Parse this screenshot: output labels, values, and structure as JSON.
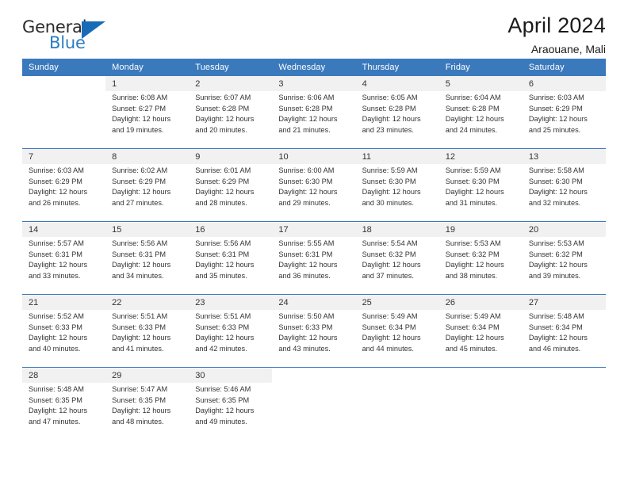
{
  "brand": {
    "word_top": "General",
    "word_bottom": "Blue",
    "triangle_color": "#1a6bb5",
    "blue_text_color": "#2b7cc4"
  },
  "header": {
    "title": "April 2024",
    "subtitle": "Araouane, Mali"
  },
  "theme": {
    "header_row_bg": "#3b79bd",
    "header_row_text": "#ffffff",
    "daynum_band_bg": "#f1f1f1",
    "week_divider": "#3b79bd",
    "body_text": "#333333"
  },
  "labels": {
    "sunrise_prefix": "Sunrise:",
    "sunset_prefix": "Sunset:",
    "daylight_prefix": "Daylight:"
  },
  "columns": [
    "Sunday",
    "Monday",
    "Tuesday",
    "Wednesday",
    "Thursday",
    "Friday",
    "Saturday"
  ],
  "weeks": [
    [
      {
        "day": "",
        "lines": []
      },
      {
        "day": "1",
        "lines": [
          "Sunrise: 6:08 AM",
          "Sunset: 6:27 PM",
          "Daylight: 12 hours",
          "and 19 minutes."
        ]
      },
      {
        "day": "2",
        "lines": [
          "Sunrise: 6:07 AM",
          "Sunset: 6:28 PM",
          "Daylight: 12 hours",
          "and 20 minutes."
        ]
      },
      {
        "day": "3",
        "lines": [
          "Sunrise: 6:06 AM",
          "Sunset: 6:28 PM",
          "Daylight: 12 hours",
          "and 21 minutes."
        ]
      },
      {
        "day": "4",
        "lines": [
          "Sunrise: 6:05 AM",
          "Sunset: 6:28 PM",
          "Daylight: 12 hours",
          "and 23 minutes."
        ]
      },
      {
        "day": "5",
        "lines": [
          "Sunrise: 6:04 AM",
          "Sunset: 6:28 PM",
          "Daylight: 12 hours",
          "and 24 minutes."
        ]
      },
      {
        "day": "6",
        "lines": [
          "Sunrise: 6:03 AM",
          "Sunset: 6:29 PM",
          "Daylight: 12 hours",
          "and 25 minutes."
        ]
      }
    ],
    [
      {
        "day": "7",
        "lines": [
          "Sunrise: 6:03 AM",
          "Sunset: 6:29 PM",
          "Daylight: 12 hours",
          "and 26 minutes."
        ]
      },
      {
        "day": "8",
        "lines": [
          "Sunrise: 6:02 AM",
          "Sunset: 6:29 PM",
          "Daylight: 12 hours",
          "and 27 minutes."
        ]
      },
      {
        "day": "9",
        "lines": [
          "Sunrise: 6:01 AM",
          "Sunset: 6:29 PM",
          "Daylight: 12 hours",
          "and 28 minutes."
        ]
      },
      {
        "day": "10",
        "lines": [
          "Sunrise: 6:00 AM",
          "Sunset: 6:30 PM",
          "Daylight: 12 hours",
          "and 29 minutes."
        ]
      },
      {
        "day": "11",
        "lines": [
          "Sunrise: 5:59 AM",
          "Sunset: 6:30 PM",
          "Daylight: 12 hours",
          "and 30 minutes."
        ]
      },
      {
        "day": "12",
        "lines": [
          "Sunrise: 5:59 AM",
          "Sunset: 6:30 PM",
          "Daylight: 12 hours",
          "and 31 minutes."
        ]
      },
      {
        "day": "13",
        "lines": [
          "Sunrise: 5:58 AM",
          "Sunset: 6:30 PM",
          "Daylight: 12 hours",
          "and 32 minutes."
        ]
      }
    ],
    [
      {
        "day": "14",
        "lines": [
          "Sunrise: 5:57 AM",
          "Sunset: 6:31 PM",
          "Daylight: 12 hours",
          "and 33 minutes."
        ]
      },
      {
        "day": "15",
        "lines": [
          "Sunrise: 5:56 AM",
          "Sunset: 6:31 PM",
          "Daylight: 12 hours",
          "and 34 minutes."
        ]
      },
      {
        "day": "16",
        "lines": [
          "Sunrise: 5:56 AM",
          "Sunset: 6:31 PM",
          "Daylight: 12 hours",
          "and 35 minutes."
        ]
      },
      {
        "day": "17",
        "lines": [
          "Sunrise: 5:55 AM",
          "Sunset: 6:31 PM",
          "Daylight: 12 hours",
          "and 36 minutes."
        ]
      },
      {
        "day": "18",
        "lines": [
          "Sunrise: 5:54 AM",
          "Sunset: 6:32 PM",
          "Daylight: 12 hours",
          "and 37 minutes."
        ]
      },
      {
        "day": "19",
        "lines": [
          "Sunrise: 5:53 AM",
          "Sunset: 6:32 PM",
          "Daylight: 12 hours",
          "and 38 minutes."
        ]
      },
      {
        "day": "20",
        "lines": [
          "Sunrise: 5:53 AM",
          "Sunset: 6:32 PM",
          "Daylight: 12 hours",
          "and 39 minutes."
        ]
      }
    ],
    [
      {
        "day": "21",
        "lines": [
          "Sunrise: 5:52 AM",
          "Sunset: 6:33 PM",
          "Daylight: 12 hours",
          "and 40 minutes."
        ]
      },
      {
        "day": "22",
        "lines": [
          "Sunrise: 5:51 AM",
          "Sunset: 6:33 PM",
          "Daylight: 12 hours",
          "and 41 minutes."
        ]
      },
      {
        "day": "23",
        "lines": [
          "Sunrise: 5:51 AM",
          "Sunset: 6:33 PM",
          "Daylight: 12 hours",
          "and 42 minutes."
        ]
      },
      {
        "day": "24",
        "lines": [
          "Sunrise: 5:50 AM",
          "Sunset: 6:33 PM",
          "Daylight: 12 hours",
          "and 43 minutes."
        ]
      },
      {
        "day": "25",
        "lines": [
          "Sunrise: 5:49 AM",
          "Sunset: 6:34 PM",
          "Daylight: 12 hours",
          "and 44 minutes."
        ]
      },
      {
        "day": "26",
        "lines": [
          "Sunrise: 5:49 AM",
          "Sunset: 6:34 PM",
          "Daylight: 12 hours",
          "and 45 minutes."
        ]
      },
      {
        "day": "27",
        "lines": [
          "Sunrise: 5:48 AM",
          "Sunset: 6:34 PM",
          "Daylight: 12 hours",
          "and 46 minutes."
        ]
      }
    ],
    [
      {
        "day": "28",
        "lines": [
          "Sunrise: 5:48 AM",
          "Sunset: 6:35 PM",
          "Daylight: 12 hours",
          "and 47 minutes."
        ]
      },
      {
        "day": "29",
        "lines": [
          "Sunrise: 5:47 AM",
          "Sunset: 6:35 PM",
          "Daylight: 12 hours",
          "and 48 minutes."
        ]
      },
      {
        "day": "30",
        "lines": [
          "Sunrise: 5:46 AM",
          "Sunset: 6:35 PM",
          "Daylight: 12 hours",
          "and 49 minutes."
        ]
      },
      {
        "day": "",
        "lines": []
      },
      {
        "day": "",
        "lines": []
      },
      {
        "day": "",
        "lines": []
      },
      {
        "day": "",
        "lines": []
      }
    ]
  ]
}
